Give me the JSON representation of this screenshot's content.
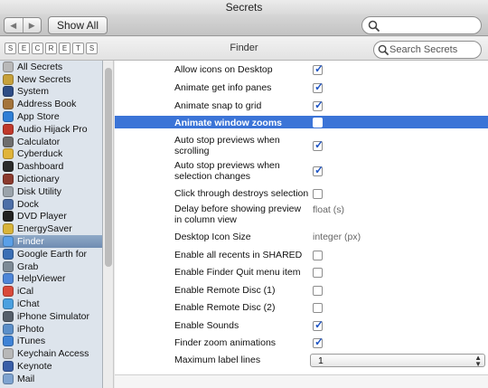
{
  "window": {
    "title": "Secrets"
  },
  "toolbar": {
    "back_glyph": "◀",
    "forward_glyph": "▶",
    "show_all_label": "Show All",
    "search_placeholder": ""
  },
  "header": {
    "logo_letters": [
      "S",
      "E",
      "C",
      "R",
      "E",
      "T",
      "S"
    ],
    "section_title": "Finder",
    "search_placeholder": "Search Secrets"
  },
  "sidebar": {
    "items": [
      {
        "label": "All Secrets",
        "color": "#b9b9b9",
        "selected": false
      },
      {
        "label": "New Secrets",
        "color": "#c7a13b",
        "selected": false
      },
      {
        "label": "System",
        "color": "#2e4d86",
        "selected": false
      },
      {
        "label": "Address Book",
        "color": "#a4743b",
        "selected": false
      },
      {
        "label": "App Store",
        "color": "#2f7fd6",
        "selected": false
      },
      {
        "label": "Audio Hijack Pro",
        "color": "#c0392b",
        "selected": false
      },
      {
        "label": "Calculator",
        "color": "#6d6d6d",
        "selected": false
      },
      {
        "label": "Cyberduck",
        "color": "#e0b43a",
        "selected": false
      },
      {
        "label": "Dashboard",
        "color": "#2b2b2b",
        "selected": false
      },
      {
        "label": "Dictionary",
        "color": "#8b3a2e",
        "selected": false
      },
      {
        "label": "Disk Utility",
        "color": "#9aa3ab",
        "selected": false
      },
      {
        "label": "Dock",
        "color": "#4d6fa8",
        "selected": false
      },
      {
        "label": "DVD Player",
        "color": "#222222",
        "selected": false
      },
      {
        "label": "EnergySaver",
        "color": "#d9b43a",
        "selected": false
      },
      {
        "label": "Finder",
        "color": "#5aa0e8",
        "selected": true
      },
      {
        "label": "Google Earth for",
        "color": "#3a6fb5",
        "selected": false
      },
      {
        "label": "Grab",
        "color": "#7d8a96",
        "selected": false
      },
      {
        "label": "HelpViewer",
        "color": "#4e86d8",
        "selected": false
      },
      {
        "label": "iCal",
        "color": "#d94a3a",
        "selected": false
      },
      {
        "label": "iChat",
        "color": "#4aa0e0",
        "selected": false
      },
      {
        "label": "iPhone Simulator",
        "color": "#555f6b",
        "selected": false
      },
      {
        "label": "iPhoto",
        "color": "#5b8fc9",
        "selected": false
      },
      {
        "label": "iTunes",
        "color": "#3f83d6",
        "selected": false
      },
      {
        "label": "Keychain Access",
        "color": "#b8b8b8",
        "selected": false
      },
      {
        "label": "Keynote",
        "color": "#3a5fa8",
        "selected": false
      },
      {
        "label": "Mail",
        "color": "#7ea3d0",
        "selected": false
      }
    ]
  },
  "settings": [
    {
      "label": "Allow icons on Desktop",
      "kind": "checkbox",
      "checked": true,
      "selected": false
    },
    {
      "label": "Animate get info panes",
      "kind": "checkbox",
      "checked": true,
      "selected": false
    },
    {
      "label": "Animate snap to grid",
      "kind": "checkbox",
      "checked": true,
      "selected": false
    },
    {
      "label": "Animate window zooms",
      "kind": "checkbox",
      "checked": false,
      "selected": true
    },
    {
      "label": "Auto stop previews when scrolling",
      "kind": "checkbox",
      "checked": true,
      "selected": false
    },
    {
      "label": "Auto stop previews when selection changes",
      "kind": "checkbox",
      "checked": true,
      "selected": false
    },
    {
      "label": "Click through destroys selection",
      "kind": "checkbox",
      "checked": false,
      "selected": false
    },
    {
      "label": "Delay before showing preview in column view",
      "kind": "text",
      "value": "float (s)",
      "selected": false
    },
    {
      "label": "Desktop Icon Size",
      "kind": "text",
      "value": "integer (px)",
      "selected": false
    },
    {
      "label": "Enable all recents in SHARED",
      "kind": "checkbox",
      "checked": false,
      "selected": false
    },
    {
      "label": "Enable Finder Quit menu item",
      "kind": "checkbox",
      "checked": false,
      "selected": false
    },
    {
      "label": "Enable Remote Disc (1)",
      "kind": "checkbox",
      "checked": false,
      "selected": false
    },
    {
      "label": "Enable Remote Disc (2)",
      "kind": "checkbox",
      "checked": false,
      "selected": false
    },
    {
      "label": "Enable Sounds",
      "kind": "checkbox",
      "checked": true,
      "selected": false
    },
    {
      "label": "Finder zoom animations",
      "kind": "checkbox",
      "checked": true,
      "selected": false
    },
    {
      "label": "Maximum label lines",
      "kind": "select",
      "value": "1",
      "selected": false
    }
  ],
  "icons": {
    "search": "magnifier-icon",
    "check": "✓",
    "select_arrows": "▲▼"
  },
  "colors": {
    "selection": "#3b74d7",
    "sidebar_bg": "#dde4ec",
    "check": "#1f55c4"
  }
}
